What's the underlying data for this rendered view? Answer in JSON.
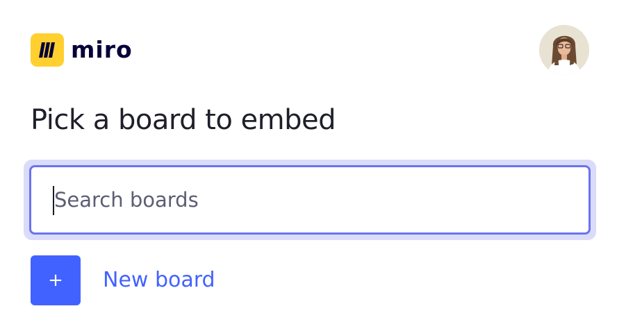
{
  "header": {
    "logo_text": "miro",
    "logo_icon": "miro-logo-icon",
    "avatar_icon": "user-avatar"
  },
  "main": {
    "title": "Pick a board to embed",
    "search": {
      "placeholder": "Search boards",
      "value": ""
    },
    "new_board": {
      "button_label": "+",
      "link_label": "New board"
    }
  },
  "colors": {
    "brand_yellow": "#FFD02F",
    "brand_dark": "#050038",
    "accent_blue": "#4262FF",
    "focus_border": "#6a73f0",
    "focus_ring": "#dadcfa"
  }
}
